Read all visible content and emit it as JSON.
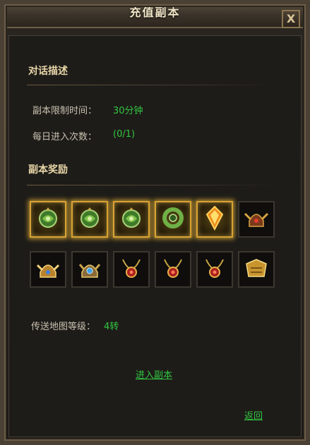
{
  "window": {
    "title": "充值副本",
    "close_label": "X"
  },
  "description": {
    "heading": "对话描述",
    "time_limit_label": "副本限制时间：",
    "time_limit_value": "30分钟",
    "daily_entries_label": "每日进入次数：",
    "daily_entries_value": "(0/1)"
  },
  "rewards": {
    "heading": "副本奖励",
    "items": [
      {
        "icon": "green-jade-pendant-icon",
        "glowing": true
      },
      {
        "icon": "green-jade-pendant-icon",
        "glowing": true
      },
      {
        "icon": "green-jade-pendant-icon",
        "glowing": true
      },
      {
        "icon": "green-jade-ring-icon",
        "glowing": true
      },
      {
        "icon": "fire-gem-icon",
        "glowing": true
      },
      {
        "icon": "winged-helmet-icon",
        "glowing": false
      },
      {
        "icon": "golden-helmet-icon",
        "glowing": false
      },
      {
        "icon": "gem-helmet-icon",
        "glowing": false
      },
      {
        "icon": "red-necklace-icon",
        "glowing": false
      },
      {
        "icon": "red-necklace-icon",
        "glowing": false
      },
      {
        "icon": "red-necklace-icon",
        "glowing": false
      },
      {
        "icon": "golden-armor-icon",
        "glowing": false
      }
    ]
  },
  "teleport": {
    "label": "传送地图等级：",
    "value": "4转"
  },
  "actions": {
    "enter_label": "进入副本",
    "back_label": "返回"
  },
  "colors": {
    "accent_green": "#31c741",
    "gold": "#e8d6a8"
  }
}
